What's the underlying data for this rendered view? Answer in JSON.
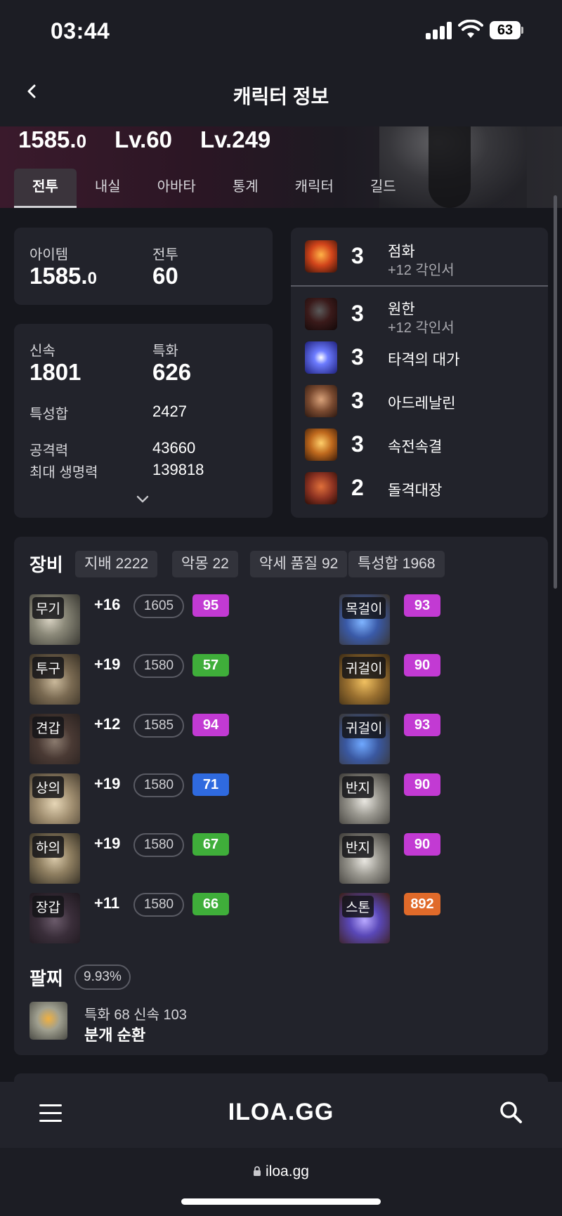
{
  "status": {
    "time": "03:44",
    "battery": "63"
  },
  "nav": {
    "title": "캐릭터 정보"
  },
  "hero": {
    "item_level_main": "1585.",
    "item_level_dec": "0",
    "combat_level": "Lv.60",
    "expedition_level": "Lv.249"
  },
  "tabs": [
    {
      "label": "전투",
      "active": true
    },
    {
      "label": "내실"
    },
    {
      "label": "아바타"
    },
    {
      "label": "통계"
    },
    {
      "label": "캐릭터"
    },
    {
      "label": "길드"
    }
  ],
  "summary": {
    "item_label": "아이템",
    "item_value_main": "1585.",
    "item_value_dec": "0",
    "combat_label": "전투",
    "combat_value": "60"
  },
  "stats": {
    "swiftness_label": "신속",
    "swiftness_value": "1801",
    "specialization_label": "특화",
    "specialization_value": "626",
    "total_label": "특성합",
    "total_value": "2427",
    "attack_label": "공격력",
    "attack_value": "43660",
    "hp_label": "최대 생명력",
    "hp_value": "139818"
  },
  "engravings": [
    {
      "level": "3",
      "name": "점화",
      "sub": "+12 각인서",
      "icon": "ignite-icon",
      "color": "#c2411b"
    },
    {
      "level": "3",
      "name": "원한",
      "sub": "+12 각인서",
      "icon": "grudge-icon",
      "color": "#5b2222"
    },
    {
      "level": "3",
      "name": "타격의 대가",
      "icon": "hit-master-icon",
      "color": "#3a49d6"
    },
    {
      "level": "3",
      "name": "아드레날린",
      "icon": "adrenaline-icon",
      "color": "#8a5a3c"
    },
    {
      "level": "3",
      "name": "속전속결",
      "icon": "swift-battle-icon",
      "color": "#b5661e"
    },
    {
      "level": "2",
      "name": "돌격대장",
      "icon": "vanguard-icon",
      "color": "#8e3322"
    }
  ],
  "equipment": {
    "title": "장비",
    "chips": [
      "지배 2222",
      "악몽 22",
      "악세 품질 92",
      "특성합 1968"
    ],
    "armor": [
      {
        "tag": "무기",
        "plus": "+16",
        "ilvl": "1605",
        "quality": "95",
        "qcolor": "#c23ad3",
        "icon": "weapon-icon"
      },
      {
        "tag": "투구",
        "plus": "+19",
        "ilvl": "1580",
        "quality": "57",
        "qcolor": "#3fae3a",
        "icon": "helmet-icon"
      },
      {
        "tag": "견갑",
        "plus": "+12",
        "ilvl": "1585",
        "quality": "94",
        "qcolor": "#c23ad3",
        "icon": "shoulder-icon"
      },
      {
        "tag": "상의",
        "plus": "+19",
        "ilvl": "1580",
        "quality": "71",
        "qcolor": "#2f6adf",
        "icon": "chest-icon"
      },
      {
        "tag": "하의",
        "plus": "+19",
        "ilvl": "1580",
        "quality": "67",
        "qcolor": "#3fae3a",
        "icon": "pants-icon"
      },
      {
        "tag": "장갑",
        "plus": "+11",
        "ilvl": "1580",
        "quality": "66",
        "qcolor": "#3fae3a",
        "icon": "gloves-icon"
      }
    ],
    "accessories": [
      {
        "tag": "목걸이",
        "quality": "93",
        "qcolor": "#c23ad3",
        "icon": "necklace-icon"
      },
      {
        "tag": "귀걸이",
        "quality": "90",
        "qcolor": "#c23ad3",
        "icon": "earring-icon"
      },
      {
        "tag": "귀걸이",
        "quality": "93",
        "qcolor": "#c23ad3",
        "icon": "earring-icon"
      },
      {
        "tag": "반지",
        "quality": "90",
        "qcolor": "#c23ad3",
        "icon": "ring-icon"
      },
      {
        "tag": "반지",
        "quality": "90",
        "qcolor": "#c23ad3",
        "icon": "ring-icon"
      },
      {
        "tag": "스톤",
        "quality": "892",
        "qcolor": "#e06a2a",
        "icon": "stone-icon"
      }
    ]
  },
  "bracelet": {
    "title": "팔찌",
    "percent": "9.93%",
    "stats": "특화 68  신속 103",
    "effects": "분개  순환"
  },
  "bottom": {
    "brand": "ILOA.GG"
  },
  "browser": {
    "url": "iloa.gg"
  }
}
